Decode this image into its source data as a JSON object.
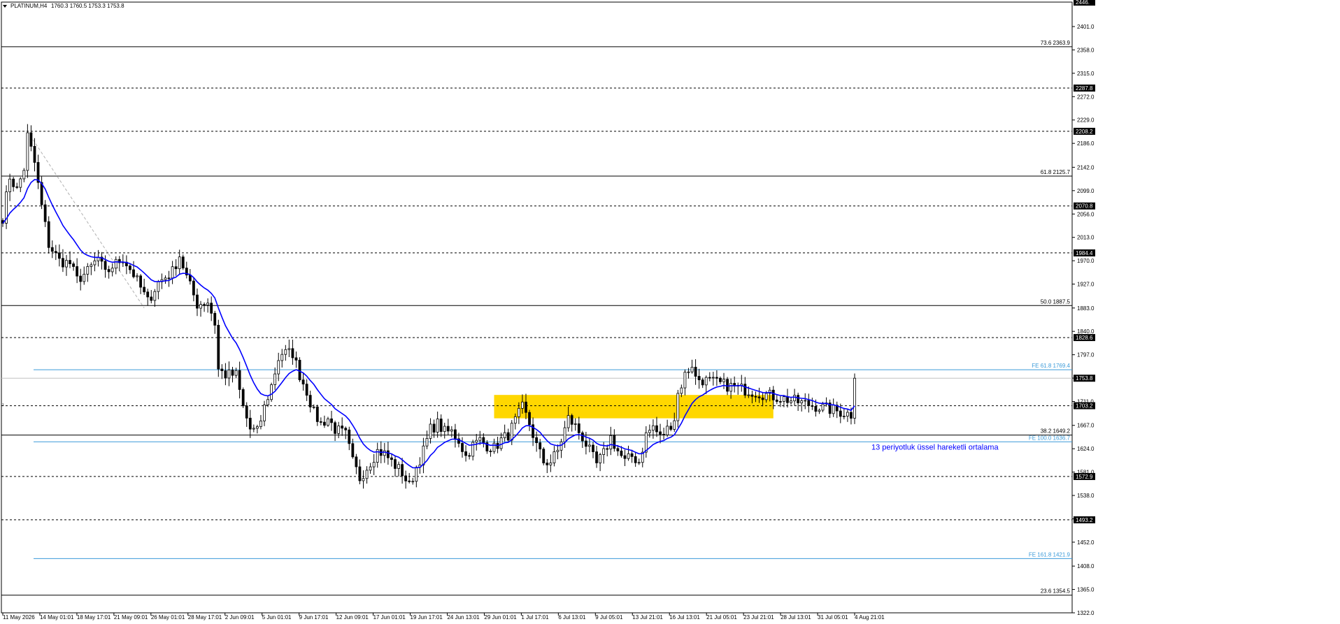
{
  "header": {
    "symbol_label": "PLATINUM,H4",
    "ohlc": "1760.3 1760.5 1753.3 1753.8"
  },
  "annotation": {
    "ema_note": "13 periyotluk üssel hareketli ortalama"
  },
  "colors": {
    "background": "#ffffff",
    "candle": "#000000",
    "ema": "#0000ff",
    "fib_line": "#000000",
    "fe_line": "#3a9ad9",
    "zone": "#ffd700",
    "grid_dash": "#000000",
    "trend_dash": "#b0b0b0"
  },
  "chart_data": {
    "type": "candlestick",
    "title": "",
    "ylim": [
      1322,
      2446
    ],
    "x_tick_labels": [
      "11 May 2026",
      "14 May 01:01",
      "18 May 17:01",
      "21 May 09:01",
      "26 May 01:01",
      "28 May 17:01",
      "2 Jun 09:01",
      "5 Jun 01:01",
      "9 Jun 17:01",
      "12 Jun 09:01",
      "17 Jun 01:01",
      "19 Jun 17:01",
      "24 Jun 13:01",
      "29 Jun 01:01",
      "1 Jul 17:01",
      "6 Jul 13:01",
      "9 Jul 05:01",
      "13 Jul 21:01",
      "16 Jul 13:01",
      "21 Jul 05:01",
      "23 Jul 21:01",
      "28 Jul 13:01",
      "31 Jul 05:01",
      "4 Aug 21:01"
    ],
    "y_tick_labels": [
      "2401.0",
      "2358.0",
      "2315.0",
      "2272.0",
      "2229.0",
      "2186.0",
      "2142.0",
      "2099.0",
      "2056.0",
      "2013.0",
      "1970.0",
      "1927.0",
      "1883.0",
      "1840.0",
      "1797.0",
      "1754.0",
      "1711.0",
      "1667.0",
      "1624.0",
      "1581.0",
      "1538.0",
      "1495.0",
      "1452.0",
      "1408.0",
      "1365.0",
      "1322.0"
    ],
    "y_ticks": [
      2401,
      2358,
      2315,
      2272,
      2229,
      2186,
      2142,
      2099,
      2056,
      2013,
      1970,
      1927,
      1883,
      1840,
      1797,
      1754,
      1711,
      1667,
      1624,
      1581,
      1538,
      1495,
      1452,
      1408,
      1365,
      1322
    ],
    "price_tags": [
      {
        "label": "2446.",
        "value": 2446
      },
      {
        "label": "2287.8",
        "value": 2287.8
      },
      {
        "label": "2208.2",
        "value": 2208.2
      },
      {
        "label": "2070.8",
        "value": 2070.8
      },
      {
        "label": "1984.4",
        "value": 1984.4
      },
      {
        "label": "1828.6",
        "value": 1828.6
      },
      {
        "label": "1753.8",
        "value": 1753.8
      },
      {
        "label": "1703.2",
        "value": 1703.2
      },
      {
        "label": "1572.9",
        "value": 1572.9
      },
      {
        "label": "1493.2",
        "value": 1493.2
      }
    ],
    "dashed_levels": [
      2446,
      2287.8,
      2208.2,
      2070.8,
      1984.4,
      1828.6,
      1703.2,
      1572.9,
      1493.2
    ],
    "fib_levels": [
      {
        "label": "73.6 2363.9",
        "value": 2363.9
      },
      {
        "label": "61.8 2125.7",
        "value": 2125.7
      },
      {
        "label": "50.0 1887.5",
        "value": 1887.5
      },
      {
        "label": "38.2 1649.2",
        "value": 1649.2
      },
      {
        "label": "23.6 1354.5",
        "value": 1354.5
      }
    ],
    "fe_levels": [
      {
        "label": "FE 61.8 1769.4",
        "value": 1769.4
      },
      {
        "label": "FE 100.0 1636.7",
        "value": 1636.7
      },
      {
        "label": "FE 161.8 1421.9",
        "value": 1421.9
      }
    ],
    "current_price": 1753.8,
    "bars": 242,
    "zone": {
      "low": 1680,
      "high": 1723,
      "start_bar": 139,
      "end_bar": 218
    },
    "trendline": {
      "from": [
        7,
        2208
      ],
      "to": [
        40,
        1883
      ]
    },
    "waypoints": [
      [
        0,
        2050
      ],
      [
        2,
        2125
      ],
      [
        4,
        2100
      ],
      [
        6,
        2140
      ],
      [
        7,
        2200
      ],
      [
        9,
        2150
      ],
      [
        11,
        2070
      ],
      [
        13,
        2000
      ],
      [
        16,
        1970
      ],
      [
        19,
        1965
      ],
      [
        21,
        1935
      ],
      [
        24,
        1950
      ],
      [
        27,
        1975
      ],
      [
        29,
        1945
      ],
      [
        31,
        1960
      ],
      [
        34,
        1975
      ],
      [
        37,
        1945
      ],
      [
        41,
        1895
      ],
      [
        44,
        1930
      ],
      [
        48,
        1950
      ],
      [
        50,
        1980
      ],
      [
        52,
        1940
      ],
      [
        55,
        1890
      ],
      [
        58,
        1895
      ],
      [
        60,
        1855
      ],
      [
        61,
        1770
      ],
      [
        63,
        1760
      ],
      [
        66,
        1760
      ],
      [
        68,
        1700
      ],
      [
        70,
        1660
      ],
      [
        72,
        1655
      ],
      [
        74,
        1700
      ],
      [
        76,
        1740
      ],
      [
        78,
        1790
      ],
      [
        79,
        1800
      ],
      [
        82,
        1800
      ],
      [
        84,
        1760
      ],
      [
        86,
        1730
      ],
      [
        88,
        1690
      ],
      [
        90,
        1670
      ],
      [
        92,
        1680
      ],
      [
        94,
        1660
      ],
      [
        97,
        1650
      ],
      [
        99,
        1600
      ],
      [
        101,
        1570
      ],
      [
        103,
        1590
      ],
      [
        106,
        1620
      ],
      [
        108,
        1615
      ],
      [
        110,
        1600
      ],
      [
        113,
        1580
      ],
      [
        115,
        1555
      ],
      [
        117,
        1590
      ],
      [
        119,
        1620
      ],
      [
        121,
        1660
      ],
      [
        123,
        1670
      ],
      [
        125,
        1655
      ],
      [
        127,
        1655
      ],
      [
        129,
        1640
      ],
      [
        131,
        1610
      ],
      [
        133,
        1630
      ],
      [
        135,
        1640
      ],
      [
        137,
        1630
      ],
      [
        139,
        1625
      ],
      [
        141,
        1640
      ],
      [
        143,
        1650
      ],
      [
        145,
        1675
      ],
      [
        147,
        1700
      ],
      [
        149,
        1670
      ],
      [
        151,
        1630
      ],
      [
        153,
        1600
      ],
      [
        155,
        1600
      ],
      [
        157,
        1620
      ],
      [
        160,
        1680
      ],
      [
        162,
        1665
      ],
      [
        164,
        1645
      ],
      [
        166,
        1620
      ],
      [
        168,
        1595
      ],
      [
        170,
        1615
      ],
      [
        172,
        1645
      ],
      [
        174,
        1620
      ],
      [
        176,
        1600
      ],
      [
        178,
        1610
      ],
      [
        180,
        1600
      ],
      [
        182,
        1650
      ],
      [
        184,
        1665
      ],
      [
        186,
        1645
      ],
      [
        188,
        1660
      ],
      [
        190,
        1680
      ],
      [
        191,
        1725
      ],
      [
        193,
        1760
      ],
      [
        195,
        1780
      ],
      [
        196,
        1753.8
      ]
    ],
    "legend": null,
    "grid": false
  }
}
